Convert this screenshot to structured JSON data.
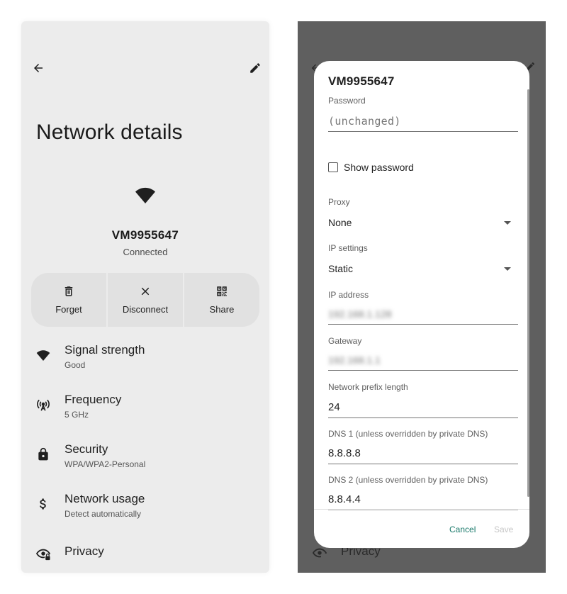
{
  "left": {
    "title": "Network details",
    "ssid": "VM9955647",
    "status": "Connected",
    "actions": [
      {
        "label": "Forget",
        "icon": "trash-icon"
      },
      {
        "label": "Disconnect",
        "icon": "close-icon"
      },
      {
        "label": "Share",
        "icon": "qr-code-icon"
      }
    ],
    "details": [
      {
        "title": "Signal strength",
        "value": "Good",
        "icon": "wifi-icon"
      },
      {
        "title": "Frequency",
        "value": "5 GHz",
        "icon": "antenna-icon"
      },
      {
        "title": "Security",
        "value": "WPA/WPA2-Personal",
        "icon": "lock-icon"
      },
      {
        "title": "Network usage",
        "value": "Detect automatically",
        "icon": "dollar-icon"
      },
      {
        "title": "Privacy",
        "value": "",
        "icon": "eye-lock-icon"
      }
    ]
  },
  "dialog": {
    "title": "VM9955647",
    "password_label": "Password",
    "password_placeholder": "(unchanged)",
    "show_password": "Show password",
    "proxy_label": "Proxy",
    "proxy_value": "None",
    "ip_settings_label": "IP settings",
    "ip_settings_value": "Static",
    "ip_address_label": "IP address",
    "ip_address_value": "192.168.1.128",
    "gateway_label": "Gateway",
    "gateway_value": "192.168.1.1",
    "prefix_label": "Network prefix length",
    "prefix_value": "24",
    "dns1_label": "DNS 1 (unless overridden by private DNS)",
    "dns1_value": "8.8.8.8",
    "dns2_label": "DNS 2 (unless overridden by private DNS)",
    "dns2_value": "8.8.4.4",
    "cancel": "Cancel",
    "save": "Save"
  },
  "background_privacy": "Privacy",
  "colors": {
    "accent": "#1b7a6b",
    "scrim": "#5f5f5f",
    "surface": "#ececec"
  }
}
